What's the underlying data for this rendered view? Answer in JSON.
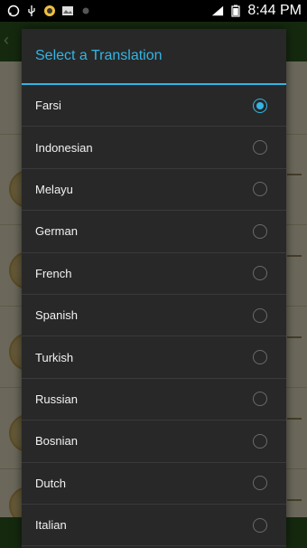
{
  "status_bar": {
    "time": "8:44 PM",
    "icons_left": [
      "whatsapp-icon",
      "usb-icon",
      "app-notification-icon",
      "image-icon",
      "dot-icon"
    ],
    "icons_right": [
      "signal-icon",
      "battery-icon"
    ]
  },
  "dialog": {
    "title": "Select a Translation",
    "selected": "Farsi",
    "options": [
      {
        "label": "Farsi",
        "checked": true
      },
      {
        "label": "Indonesian",
        "checked": false
      },
      {
        "label": "Melayu",
        "checked": false
      },
      {
        "label": "German",
        "checked": false
      },
      {
        "label": "French",
        "checked": false
      },
      {
        "label": "Spanish",
        "checked": false
      },
      {
        "label": "Turkish",
        "checked": false
      },
      {
        "label": "Russian",
        "checked": false
      },
      {
        "label": "Bosnian",
        "checked": false
      },
      {
        "label": "Dutch",
        "checked": false
      },
      {
        "label": "Italian",
        "checked": false
      }
    ]
  },
  "colors": {
    "accent": "#33b5e5",
    "dialog_bg": "#282828",
    "app_header": "#2f5c23",
    "page_bg": "#ede7c9"
  }
}
